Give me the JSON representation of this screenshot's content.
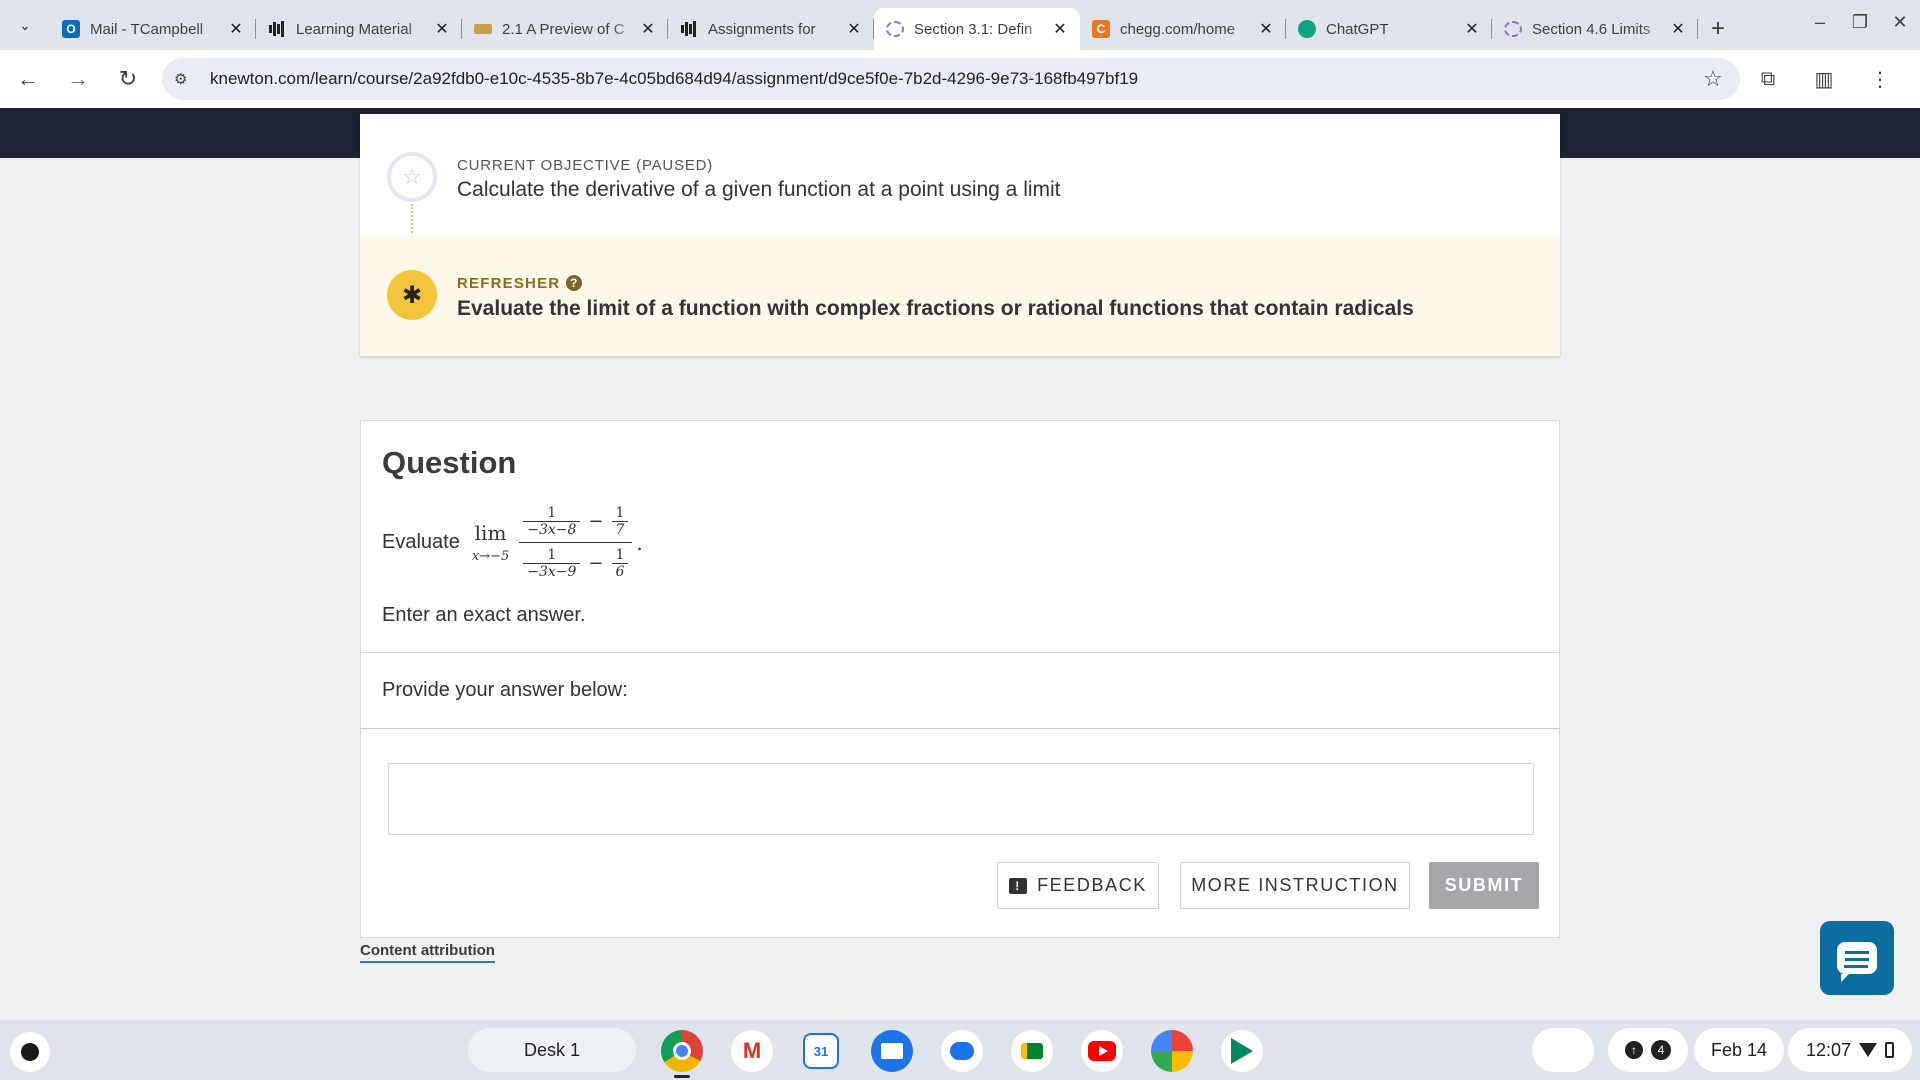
{
  "browser": {
    "tabs": [
      {
        "title": "Mail - TCampbell",
        "favicon": "outlook-icon"
      },
      {
        "title": "Learning Material",
        "favicon": "bars-icon"
      },
      {
        "title": "2.1 A Preview of C",
        "favicon": "book-icon"
      },
      {
        "title": "Assignments for",
        "favicon": "bars-icon"
      },
      {
        "title": "Section 3.1: Defin",
        "favicon": "knewton-icon",
        "active": true
      },
      {
        "title": "chegg.com/home",
        "favicon": "chegg-icon"
      },
      {
        "title": "ChatGPT",
        "favicon": "chatgpt-icon"
      },
      {
        "title": "Section 4.6 Limits",
        "favicon": "knewton-icon"
      }
    ],
    "tab_close_glyph": "✕",
    "new_tab_glyph": "+",
    "url": "knewton.com/learn/course/2a92fdb0-e10c-4535-8b7e-4c05bd684d94/assignment/d9ce5f0e-7b2d-4296-9e73-168fb497bf19"
  },
  "objective": {
    "label": "CURRENT OBJECTIVE (PAUSED)",
    "text": "Calculate the derivative of a given function at a point using a limit",
    "star_glyph": "☆"
  },
  "refresher": {
    "label": "REFRESHER",
    "help_glyph": "?",
    "text": "Evaluate the limit of a function with complex fractions or rational functions that contain radicals",
    "puzzle_glyph": "✱"
  },
  "question": {
    "title": "Question",
    "prompt": "Evaluate",
    "math": {
      "lim_word": "lim",
      "lim_sub": "x→−5",
      "top_frac": {
        "num": "1",
        "den": "−3x−8"
      },
      "top_const": {
        "num": "1",
        "den": "7"
      },
      "bottom_frac": {
        "num": "1",
        "den": "−3x−9"
      },
      "bottom_const": {
        "num": "1",
        "den": "6"
      },
      "minus": "−",
      "period": "."
    },
    "instruction": "Enter an exact answer.",
    "provide_label": "Provide your answer below:",
    "answer_value": ""
  },
  "buttons": {
    "feedback": "FEEDBACK",
    "more_instruction": "MORE INSTRUCTION",
    "submit": "SUBMIT"
  },
  "content_attribution": "Content attribution",
  "shelf": {
    "desk_label": "Desk 1",
    "calendar_day": "31",
    "notification_count": "4",
    "date": "Feb 14",
    "time": "12:07"
  },
  "colors": {
    "nav_band": "#1e2235",
    "refresher_bg": "#fdf8ea",
    "puzzle_accent": "#f3c43c",
    "submit_disabled": "#a6a7ab",
    "chat_button": "#0b6e9e",
    "link_underline": "#2a7cb5"
  }
}
